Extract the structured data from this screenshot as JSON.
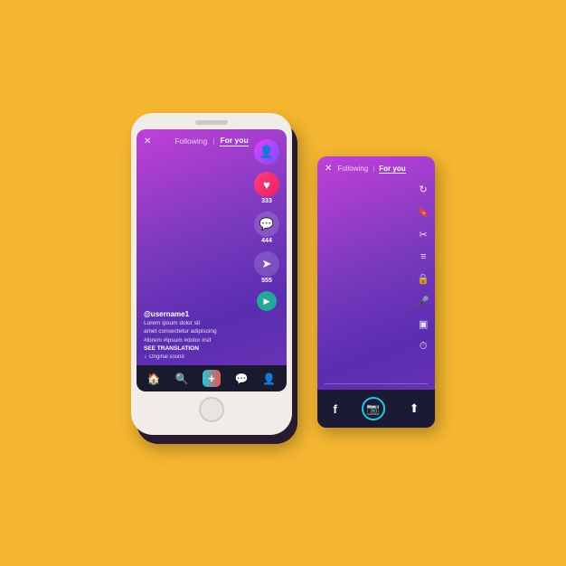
{
  "background": "#F5B731",
  "phone": {
    "header": {
      "close": "✕",
      "tab_following": "Following",
      "divider": "|",
      "tab_foryou": "For you"
    },
    "content": {
      "username": "@username1",
      "description1": "Lorem ipsum dolor sit",
      "description2": "amet consectetur adipiscing",
      "hashtags": "#lorem #ipsum #dolor #sit",
      "see_translation": "SEE TRANSLATION",
      "sound": "♪ Original sound"
    },
    "icons": {
      "profile_icon": "👤",
      "likes": "333",
      "comments": "444",
      "shares": "555"
    },
    "bottom_nav": {
      "home": "🏠",
      "search": "🔍",
      "add": "+",
      "inbox": "💬",
      "profile": "👤"
    }
  },
  "flat_phone": {
    "header": {
      "close": "✕",
      "tab_following": "Following",
      "divider": "|",
      "tab_foryou": "For you"
    },
    "right_icons": [
      "↻",
      "🔖",
      "✂",
      "≡",
      "🔒",
      "🎤",
      "▣",
      "⏱"
    ],
    "bottom_share": {
      "facebook": "f",
      "camera": "📷",
      "upload": "⬆"
    }
  }
}
